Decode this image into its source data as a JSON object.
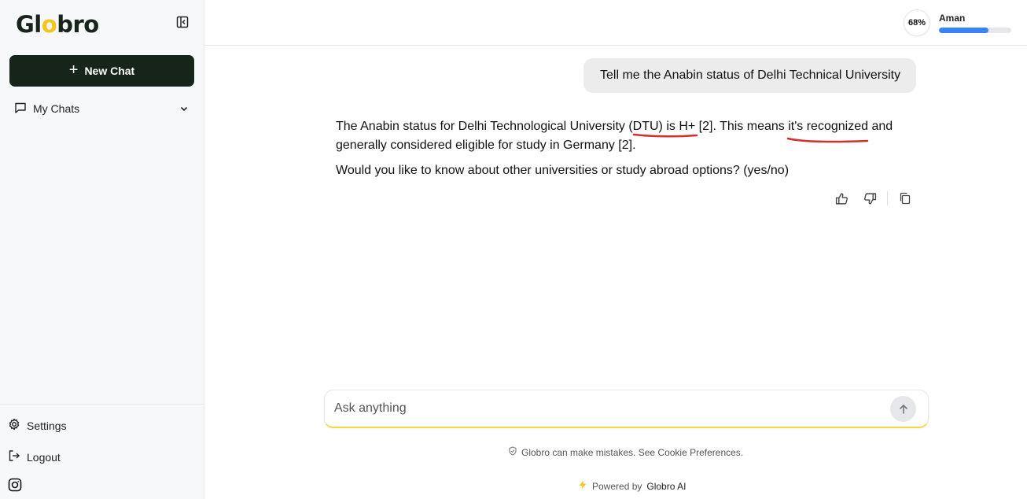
{
  "sidebar": {
    "logo_prefix": "Gl",
    "logo_mid": "o",
    "logo_suffix": "bro",
    "new_chat_label": "New Chat",
    "my_chats_label": "My Chats",
    "settings_label": "Settings",
    "logout_label": "Logout",
    "icons": [
      "sidebar-collapse-icon",
      "plus-icon",
      "chat-bubble-icon",
      "chevron-down-icon",
      "gear-icon",
      "logout-icon",
      "instagram-icon"
    ]
  },
  "header": {
    "progress_label": "68%",
    "progress_value": 0.68,
    "user_name": "Aman",
    "bar_value": 0.68,
    "bar_color": "#3b82f6"
  },
  "chat": {
    "user_message": "Tell me the Anabin status of Delhi Technical University",
    "answer_p1_a": "The Anabin status for Delhi Technological University (",
    "answer_p1_b": "DTU) is H+",
    "answer_p1_c": " [2]. This means ",
    "answer_p1_d": "it's recognized",
    "answer_p1_e": " and generally considered eligible for study in Germany [2].",
    "answer_p2": "Would you like to know about other universities or study abroad options? (yes/no)",
    "actions": [
      "thumbs-up-icon",
      "thumbs-down-icon",
      "copy-icon"
    ]
  },
  "composer": {
    "placeholder": "Ask anything",
    "value": ""
  },
  "footer": {
    "disclaimer_text": "Globro can make mistakes. See ",
    "disclaimer_link": "Cookie Preferences",
    "disclaimer_end": ".",
    "powered_text": "Powered by",
    "powered_brand": "Globro AI"
  },
  "colors": {
    "brand_dark": "#16241a",
    "accent_yellow": "#f5c518",
    "annotation_red": "#d32f2f"
  }
}
